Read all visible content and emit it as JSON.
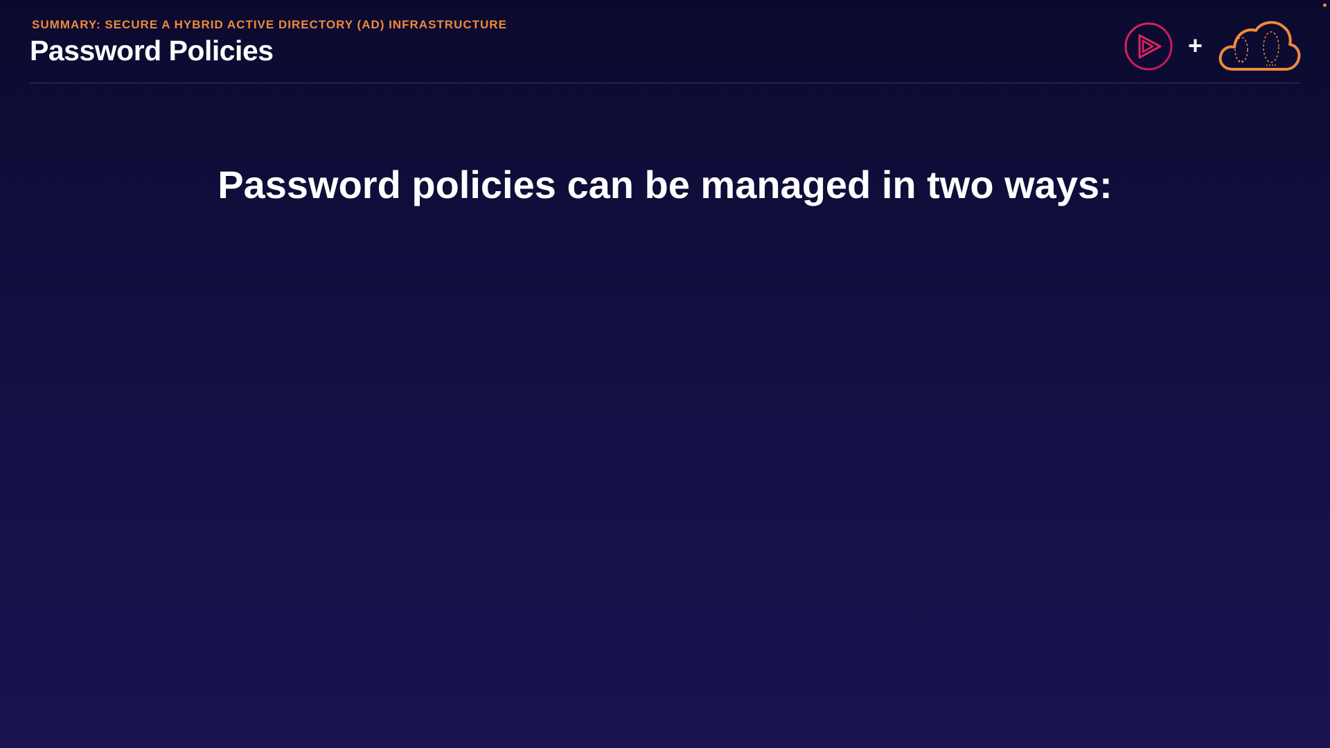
{
  "header": {
    "subtitle": "SUMMARY: SECURE A HYBRID ACTIVE DIRECTORY (AD) INFRASTRUCTURE",
    "title": "Password Policies",
    "plus": "+",
    "logos": [
      "play-logo-icon",
      "cloud-logo-icon"
    ]
  },
  "main": {
    "headline": "Password policies can be managed in two ways:"
  },
  "colors": {
    "background_top": "#0b0a2e",
    "background_bottom": "#1a1352",
    "subtitle": "#f08a3c",
    "play_logo": "#e0245e",
    "cloud_logo": "#f08a3c",
    "text": "#ffffff"
  }
}
